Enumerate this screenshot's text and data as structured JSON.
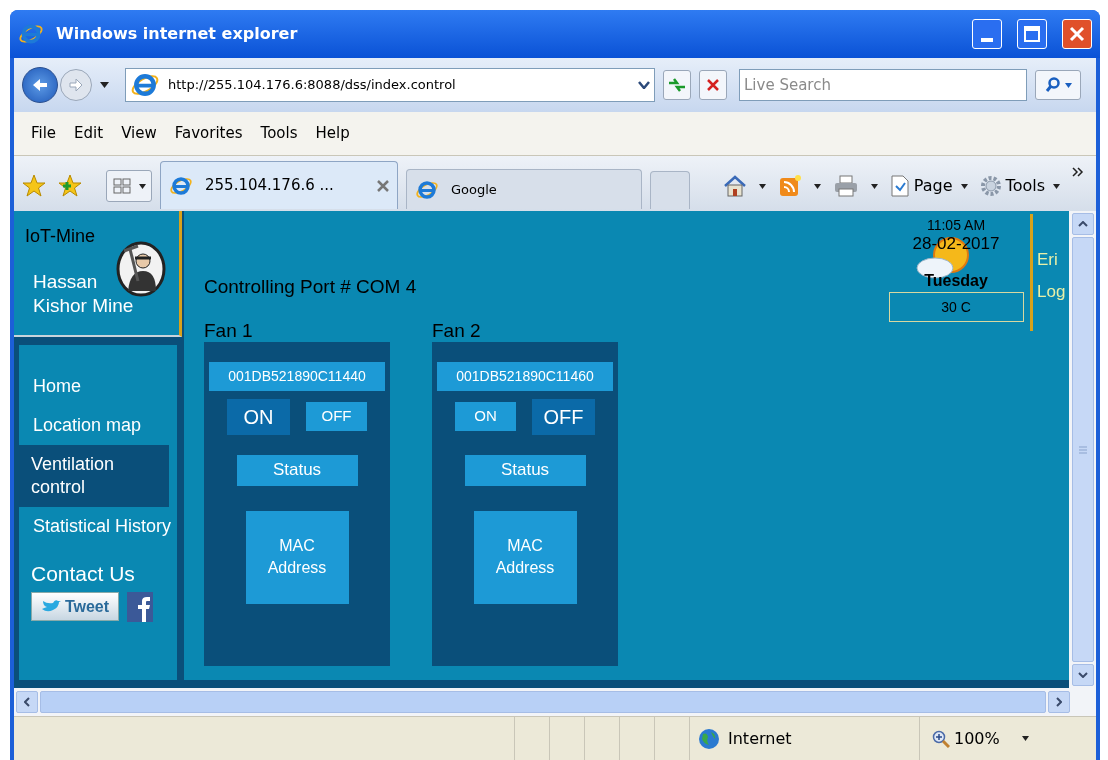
{
  "window": {
    "title": "Windows internet explorer"
  },
  "address_bar": {
    "url": "http://255.104.176.6:8088/dss/index.control"
  },
  "search": {
    "placeholder": "Live Search"
  },
  "menu": [
    "File",
    "Edit",
    "View",
    "Favorites",
    "Tools",
    "Help"
  ],
  "tabs": [
    {
      "label": "255.104.176.6 ...",
      "selected": true
    },
    {
      "label": "Google",
      "selected": false
    }
  ],
  "command_bar": [
    "Page",
    "Tools"
  ],
  "sidebar": {
    "brand": "IoT-Mine",
    "site_lines": [
      "Hassan",
      "Kishor Mine"
    ],
    "nav": [
      {
        "label": "Home",
        "selected": false
      },
      {
        "label": "Location map",
        "selected": false
      },
      {
        "label": "Ventilation control",
        "selected": true
      },
      {
        "label": "Statistical History",
        "selected": false
      }
    ],
    "contact": "Contact Us",
    "tweet": "Tweet"
  },
  "main": {
    "port": "Controlling Port # COM 4",
    "fans": [
      {
        "label": "Fan 1",
        "device_id": "001DB521890C11440",
        "switches": [
          {
            "label": "ON",
            "selected": true
          },
          {
            "label": "OFF",
            "selected": false
          }
        ],
        "status": "Status",
        "mac": "MAC Address"
      },
      {
        "label": "Fan 2",
        "device_id": "001DB521890C11460",
        "switches": [
          {
            "label": "ON",
            "selected": false
          },
          {
            "label": "OFF",
            "selected": true
          }
        ],
        "status": "Status",
        "mac": "MAC Address"
      }
    ]
  },
  "clock": {
    "time": "11:05 AM",
    "date": "28-02-2017",
    "day": "Tuesday",
    "temperature": "30 C"
  },
  "user_links": [
    "Eri",
    "Log"
  ],
  "status_bar": {
    "zone": "Internet",
    "zoom": "100%"
  }
}
